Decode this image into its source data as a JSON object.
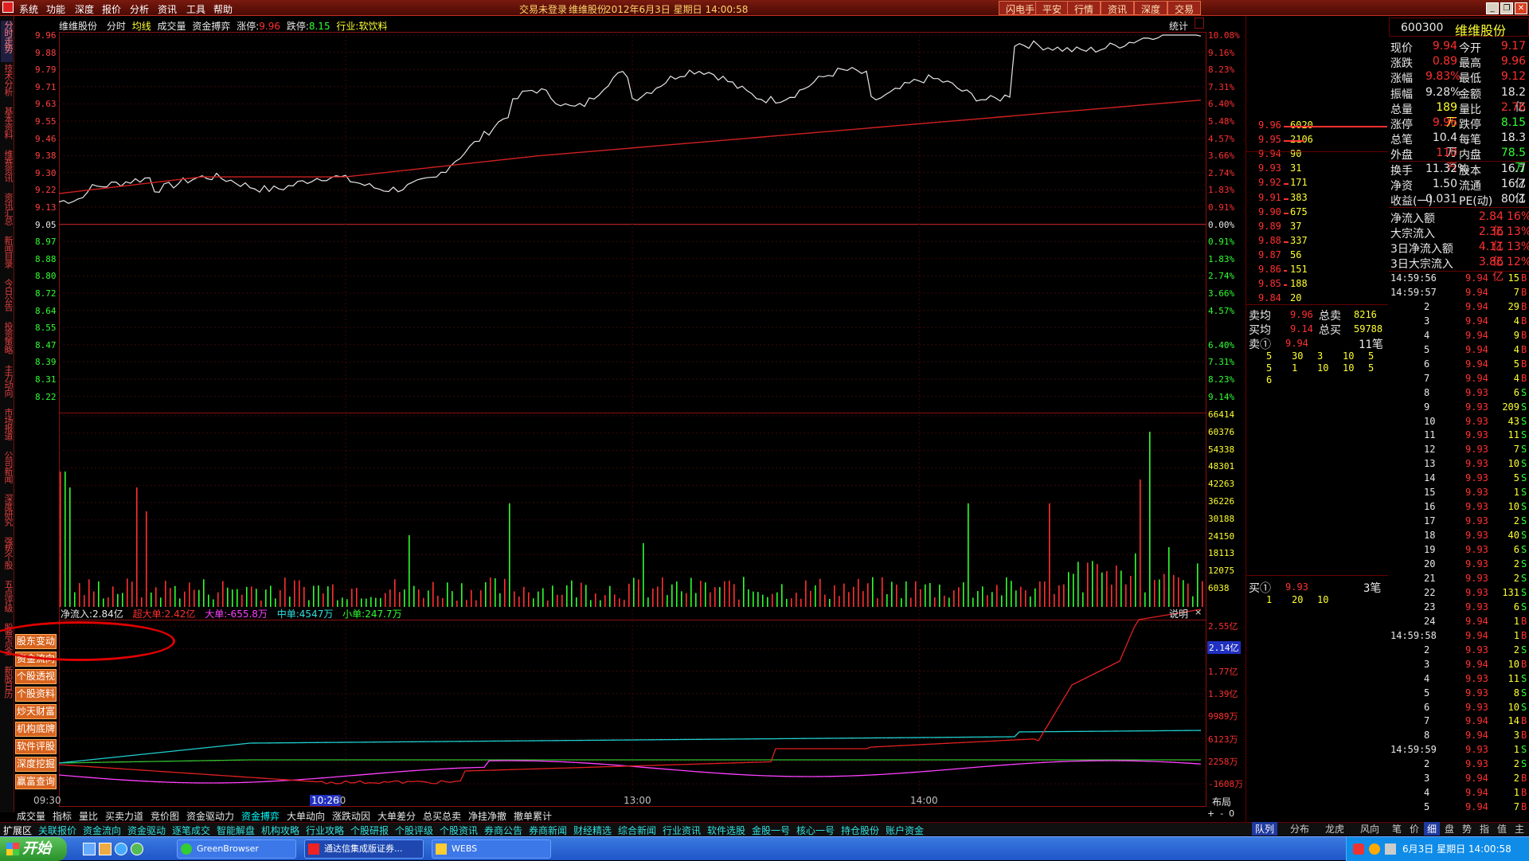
{
  "menu": {
    "items": [
      "系统",
      "功能",
      "深度",
      "报价",
      "分析",
      "资讯",
      "工具",
      "帮助"
    ],
    "login_status": "交易未登录",
    "stock_name": "维维股份",
    "date_time": "2012年6月3日 星期日 14:00:58",
    "right_buttons": [
      "闪电手",
      "平安",
      "行情",
      "资讯",
      "深度",
      "交易"
    ]
  },
  "vertical_tabs": [
    "分时走势",
    "技术分析",
    "基本资料",
    "维赛资讯",
    "资讯汇总",
    "新闻目录",
    "今日公告",
    "投资策略",
    "主力动向",
    "市场报道",
    "公司新闻",
    "深度研究",
    "强势个股",
    "五点评级",
    "股票点金",
    "新股日历"
  ],
  "chart_header": {
    "name": "维维股份",
    "period": "分时",
    "avg_label": "均线",
    "vol_label": "成交量",
    "mode_label": "资金搏弈",
    "limit_up_label": "涨停:",
    "limit_up": "9.96",
    "limit_down_label": "跌停:",
    "limit_down": "8.15",
    "industry": "行业:软饮料",
    "stats_btn": "统计"
  },
  "price_axis": {
    "left": [
      "9.96",
      "9.88",
      "9.79",
      "9.71",
      "9.63",
      "9.55",
      "9.46",
      "9.38",
      "9.30",
      "9.22",
      "9.13",
      "9.05",
      "8.97",
      "8.88",
      "8.80",
      "8.72",
      "8.64",
      "8.55",
      "8.47",
      "8.39",
      "8.31",
      "8.22"
    ],
    "right": [
      "10.08%",
      "9.16%",
      "8.23%",
      "7.31%",
      "6.40%",
      "5.48%",
      "4.57%",
      "3.66%",
      "2.74%",
      "1.83%",
      "0.91%",
      "0.00%",
      "0.91%",
      "1.83%",
      "2.74%",
      "3.66%",
      "4.57%",
      "6.40%",
      "7.31%",
      "8.23%",
      "9.14%"
    ]
  },
  "volume_axis": [
    "66414",
    "60376",
    "54338",
    "48301",
    "42263",
    "36226",
    "30188",
    "24150",
    "18113",
    "12075",
    "6038"
  ],
  "flow_header": {
    "net_inflow": "净流入:2.84亿",
    "super": "超大单:2.42亿",
    "large": "大单:-655.8万",
    "medium": "中单:4547万",
    "small": "小单:247.7万",
    "explain_btn": "说明"
  },
  "flow_axis": [
    "2.55亿",
    "2.14亿",
    "1.77亿",
    "1.39亿",
    "9989万",
    "6123万",
    "2258万",
    "-1608万"
  ],
  "time_axis": [
    "09:30",
    "10:26",
    "30",
    "13:00",
    "14:00"
  ],
  "layout_btn": "布局",
  "feature_buttons": [
    "股东变动",
    "资金流向",
    "个股透视",
    "个股资料",
    "炒天财富",
    "机构底牌",
    "软件评股",
    "深度挖掘",
    "赢富查询"
  ],
  "bottom_tabs_1": [
    "成交量",
    "指标",
    "量比",
    "买卖力道",
    "竞价图",
    "资金驱动力",
    "资金搏弈",
    "大单动向",
    "涨跌动因",
    "大单差分",
    "总买总卖",
    "净挂净撤",
    "撤单累计"
  ],
  "bottom_tabs_2": [
    "扩展区",
    "关联报价",
    "资金流向",
    "资金驱动",
    "逐笔成交",
    "智能解盘",
    "机构攻略",
    "行业攻略",
    "个股研报",
    "个股评级",
    "个股资讯",
    "券商公告",
    "券商新闻",
    "财经精选",
    "综合新闻",
    "行业资讯",
    "软件选股",
    "金股一号",
    "核心一号",
    "持仓股份",
    "账户资金"
  ],
  "right_tabs": [
    "队列",
    "分布",
    "龙虎",
    "风向",
    "笔",
    "价",
    "细",
    "盘",
    "势",
    "指",
    "值",
    "主"
  ],
  "code": "600300",
  "name": "维维股份",
  "quote": [
    [
      "现价",
      "9.94",
      "今开",
      "9.17"
    ],
    [
      "涨跌",
      "0.89",
      "最高",
      "9.96"
    ],
    [
      "涨幅",
      "9.83%",
      "最低",
      "9.12"
    ],
    [
      "振幅",
      "9.28%",
      "金额",
      "18.2亿"
    ],
    [
      "总量",
      "189万",
      "量比",
      "2.76"
    ],
    [
      "涨停",
      "9.96",
      "跌停",
      "8.15"
    ],
    [
      "总笔",
      "10.4万",
      "每笔",
      "18.3"
    ],
    [
      "外盘",
      "110万",
      "内盘",
      "78.5万"
    ],
    [
      "换手",
      "11.32%",
      "股本",
      "16.7亿"
    ],
    [
      "净资",
      "1.50",
      "流通",
      "16.7亿"
    ],
    [
      "收益(一)",
      "0.031",
      "PE(动)",
      "80.1"
    ]
  ],
  "flows": [
    [
      "净流入额",
      "2.84亿",
      "16%"
    ],
    [
      "大宗流入",
      "2.36亿",
      "13%"
    ],
    [
      "3日净流入额",
      "4.11亿",
      "13%"
    ],
    [
      "3日大宗流入",
      "3.86亿",
      "12%"
    ]
  ],
  "order_book_sell": [
    [
      "9.96",
      "6020"
    ],
    [
      "9.95",
      "2106"
    ],
    [
      "9.94",
      "90"
    ],
    [
      "9.93",
      "31"
    ],
    [
      "9.92",
      "171"
    ],
    [
      "9.91",
      "383"
    ],
    [
      "9.90",
      "675"
    ],
    [
      "9.89",
      "37"
    ],
    [
      "9.88",
      "337"
    ],
    [
      "9.87",
      "56"
    ],
    [
      "9.86",
      "151"
    ],
    [
      "9.85",
      "188"
    ],
    [
      "9.84",
      "20"
    ]
  ],
  "book_summary": {
    "sell_avg_label": "卖均",
    "sell_avg": "9.96",
    "sell_total_label": "总卖",
    "sell_total": "8216",
    "buy_avg_label": "买均",
    "buy_avg": "9.14",
    "buy_total_label": "总买",
    "buy_total": "59788",
    "sell1_label": "卖①",
    "sell1_price": "9.94",
    "sell1_count": "11笔",
    "sell_queue": [
      [
        "5",
        "30",
        "3",
        "10",
        "5"
      ],
      [
        "5",
        "1",
        "10",
        "10",
        "5"
      ],
      [
        "6"
      ]
    ],
    "buy1_label": "买①",
    "buy1_price": "9.93",
    "buy1_count": "3笔",
    "buy_queue": [
      "1",
      "20",
      "10"
    ]
  },
  "ticks": [
    [
      "14:59:56",
      "9.94",
      "15",
      "B"
    ],
    [
      "14:59:57",
      "9.94",
      "7",
      "B"
    ],
    [
      "2",
      "9.94",
      "29",
      "B"
    ],
    [
      "3",
      "9.94",
      "4",
      "B"
    ],
    [
      "4",
      "9.94",
      "9",
      "B"
    ],
    [
      "5",
      "9.94",
      "4",
      "B"
    ],
    [
      "6",
      "9.94",
      "5",
      "B"
    ],
    [
      "7",
      "9.94",
      "4",
      "B"
    ],
    [
      "8",
      "9.93",
      "6",
      "S"
    ],
    [
      "9",
      "9.93",
      "209",
      "S"
    ],
    [
      "10",
      "9.93",
      "43",
      "S"
    ],
    [
      "11",
      "9.93",
      "11",
      "S"
    ],
    [
      "12",
      "9.93",
      "7",
      "S"
    ],
    [
      "13",
      "9.93",
      "10",
      "S"
    ],
    [
      "14",
      "9.93",
      "5",
      "S"
    ],
    [
      "15",
      "9.93",
      "1",
      "S"
    ],
    [
      "16",
      "9.93",
      "10",
      "S"
    ],
    [
      "17",
      "9.93",
      "2",
      "S"
    ],
    [
      "18",
      "9.93",
      "40",
      "S"
    ],
    [
      "19",
      "9.93",
      "6",
      "S"
    ],
    [
      "20",
      "9.93",
      "2",
      "S"
    ],
    [
      "21",
      "9.93",
      "2",
      "S"
    ],
    [
      "22",
      "9.93",
      "131",
      "S"
    ],
    [
      "23",
      "9.93",
      "6",
      "S"
    ],
    [
      "24",
      "9.94",
      "1",
      "B"
    ],
    [
      "14:59:58",
      "9.94",
      "1",
      "B"
    ],
    [
      "2",
      "9.93",
      "2",
      "S"
    ],
    [
      "3",
      "9.94",
      "10",
      "B"
    ],
    [
      "4",
      "9.93",
      "11",
      "S"
    ],
    [
      "5",
      "9.93",
      "8",
      "S"
    ],
    [
      "6",
      "9.93",
      "10",
      "S"
    ],
    [
      "7",
      "9.94",
      "14",
      "B"
    ],
    [
      "8",
      "9.94",
      "3",
      "B"
    ],
    [
      "14:59:59",
      "9.93",
      "1",
      "S"
    ],
    [
      "2",
      "9.93",
      "2",
      "S"
    ],
    [
      "3",
      "9.94",
      "2",
      "B"
    ],
    [
      "4",
      "9.94",
      "1",
      "B"
    ],
    [
      "5",
      "9.94",
      "7",
      "B"
    ]
  ],
  "taskbar": {
    "start": "开始",
    "tasks": [
      "GreenBrowser",
      "通达信集成版证券...",
      "WEBS"
    ],
    "tray_date": "6月3日 星期日 14:00:58"
  },
  "colors": {
    "up": "#ff3030",
    "down": "#30ff30",
    "price": "#e8e8e8",
    "avg": "#d02020",
    "grid": "#8a1010"
  }
}
